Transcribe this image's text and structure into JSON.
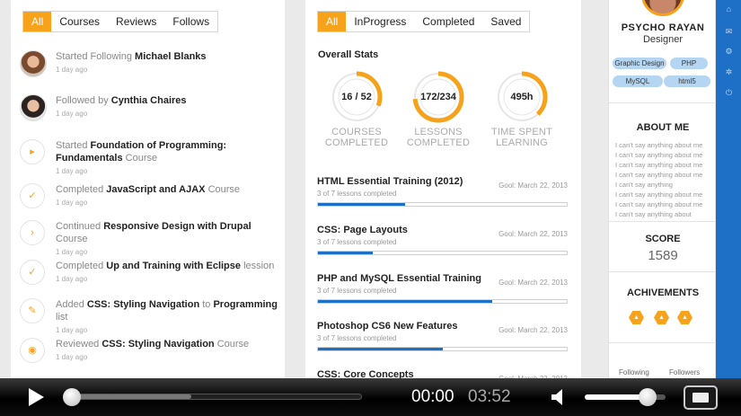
{
  "activity": {
    "tabs": [
      "All",
      "Courses",
      "Reviews",
      "Follows"
    ],
    "active_tab": "All",
    "items": [
      {
        "type": "avatar",
        "avatar": "avatar-woman-1",
        "pre": "Started Following ",
        "b1": "Michael Blanks",
        "mid": "",
        "b2": "",
        "post": "",
        "ago": "1 day ago"
      },
      {
        "type": "avatar",
        "avatar": "avatar-woman-2",
        "pre": "Followed by ",
        "b1": "Cynthia Chaires",
        "mid": "",
        "b2": "",
        "post": "",
        "ago": "1 day ago"
      },
      {
        "type": "icon",
        "icon": "play-icon",
        "glyph": "▸",
        "pre": "Started ",
        "b1": "Foundation of Programming: Fundamentals",
        "mid": "",
        "b2": "",
        "post": " Course",
        "ago": "1 day ago"
      },
      {
        "type": "icon",
        "icon": "check-icon",
        "glyph": "✓",
        "pre": "Completed ",
        "b1": "JavaScript and AJAX",
        "mid": "",
        "b2": "",
        "post": " Course",
        "ago": "1 day ago"
      },
      {
        "type": "icon",
        "icon": "chevron-right-icon",
        "glyph": "›",
        "pre": "Continued ",
        "b1": "Responsive Design with Drupal",
        "mid": "",
        "b2": "",
        "post": " Course",
        "ago": "1 day ago"
      },
      {
        "type": "icon",
        "icon": "check-icon",
        "glyph": "✓",
        "pre": "Completed ",
        "b1": "Up and Training with Eclipse",
        "mid": "",
        "b2": "",
        "post": " lession",
        "ago": "1 day ago"
      },
      {
        "type": "icon",
        "icon": "pin-icon",
        "glyph": "✎",
        "pre": "Added ",
        "b1": "CSS: Styling Navigation",
        "mid": " to ",
        "b2": "Programming",
        "post": " list",
        "ago": "1 day ago"
      },
      {
        "type": "icon",
        "icon": "eye-icon",
        "glyph": "◉",
        "pre": "Reviewed ",
        "b1": "CSS: Styling Navigation",
        "mid": "",
        "b2": "",
        "post": " Course",
        "ago": "1 day ago"
      }
    ]
  },
  "stats": {
    "tabs": [
      "All",
      "InProgress",
      "Completed",
      "Saved"
    ],
    "active_tab": "All",
    "title": "Overall Stats",
    "items": [
      {
        "key": "courses",
        "value": "16 / 52",
        "label1": "COURSES",
        "label2": "COMPLETED",
        "fraction": 0.31
      },
      {
        "key": "lessons",
        "value": "172/234",
        "label1": "LESSONS",
        "label2": "COMPLETED",
        "fraction": 0.735
      },
      {
        "key": "time",
        "value": "495h",
        "label1": "TIME SPENT",
        "label2": "LEARNING",
        "fraction": 0.38
      }
    ],
    "accent": "#f7a21b",
    "bar_color": "#1e6fc6"
  },
  "courses": [
    {
      "title": "HTML Essential Training (2012)",
      "sub": "3 of 7 lessons completed",
      "goal": "Gool: March 22, 2013",
      "progress": 0.35
    },
    {
      "title": "CSS: Page Layouts",
      "sub": "3 of 7 lessons completed",
      "goal": "Gool: March 22, 2013",
      "progress": 0.22
    },
    {
      "title": "PHP and MySQL Essential Training",
      "sub": "3 of 7 lessons completed",
      "goal": "Gool: March 22, 2013",
      "progress": 0.7
    },
    {
      "title": "Photoshop CS6 New Features",
      "sub": "3 of 7 lessons completed",
      "goal": "Gool: March 22, 2013",
      "progress": 0.5
    },
    {
      "title": "CSS: Core Concepts",
      "sub": "",
      "goal": "Gool: March 22, 2013",
      "progress": 0
    }
  ],
  "profile": {
    "name": "PSYCHO RAYAN",
    "role": "Designer",
    "skills": [
      "Graphic Design",
      "PHP",
      "MySQL",
      "html5"
    ],
    "about_title": "ABOUT ME",
    "about_lines": [
      "I can't say anything about me",
      "I can't say anything about me",
      "I can't say anything about me",
      "I can't say anything about me",
      "I can't say anything",
      "I can't say anything about me",
      "I can't say anything about me",
      "I can't say anything about"
    ],
    "score_title": "SCORE",
    "score": "1589",
    "ach_title": "ACHIVEMENTS",
    "following_label": "Following",
    "followers_label": "Followers"
  },
  "player": {
    "current_time": "00:00",
    "duration": "03:52",
    "progress": 0.0,
    "buffered": 0.43,
    "volume": 0.8
  }
}
